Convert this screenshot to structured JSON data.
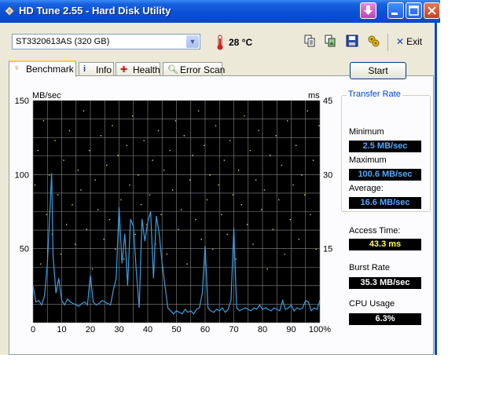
{
  "window": {
    "title": "HD Tune 2.55 - Hard Disk Utility"
  },
  "toolbar": {
    "drive": "ST3320613AS (320 GB)",
    "temperature": "28 °C",
    "exit_label": "Exit",
    "icons": [
      "copy-text-icon",
      "copy-screenshot-icon",
      "save-icon",
      "options-icon"
    ]
  },
  "tabs": [
    {
      "label": "Benchmark",
      "icon": "benchmark-icon",
      "active": true
    },
    {
      "label": "Info",
      "icon": "info-icon",
      "active": false
    },
    {
      "label": "Health",
      "icon": "health-icon",
      "active": false
    },
    {
      "label": "Error Scan",
      "icon": "error-scan-icon",
      "active": false
    }
  ],
  "benchmark": {
    "start_label": "Start",
    "transfer_rate_title": "Transfer Rate",
    "minimum_label": "Minimum",
    "minimum_value": "2.5 MB/sec",
    "maximum_label": "Maximum",
    "maximum_value": "100.6 MB/sec",
    "average_label": "Average:",
    "average_value": "16.6 MB/sec",
    "access_time_label": "Access Time:",
    "access_time_value": "43.3 ms",
    "burst_rate_label": "Burst Rate",
    "burst_rate_value": "35.3 MB/sec",
    "cpu_usage_label": "CPU Usage",
    "cpu_usage_value": "6.3%"
  },
  "chart_data": {
    "type": "line",
    "ylabel": "MB/sec",
    "y2label": "ms",
    "ylim": [
      0,
      150
    ],
    "y2lim": [
      0,
      45
    ],
    "xlim": [
      0,
      100
    ],
    "xticks": [
      "0",
      "10",
      "20",
      "30",
      "40",
      "50",
      "60",
      "70",
      "80",
      "90",
      "100%"
    ],
    "yticks": [
      "150",
      "100",
      "50"
    ],
    "y2ticks": [
      "45",
      "30",
      "15"
    ],
    "grid": true,
    "colors": {
      "background": "#000000",
      "grid": "#8a8a8a",
      "transfer": "#3a9fe0",
      "access": "#d8d840"
    },
    "series": [
      {
        "x": [
          0,
          1,
          2,
          3,
          4,
          5,
          6,
          6.5,
          7,
          8,
          9,
          10,
          11,
          12,
          13,
          14,
          15,
          16,
          17,
          18,
          19,
          20,
          21,
          22,
          23,
          24,
          25,
          26,
          27,
          28,
          29,
          30,
          31,
          32,
          33,
          34,
          35,
          36,
          37,
          38,
          39,
          40,
          41,
          42,
          43,
          44,
          45,
          46,
          47,
          48,
          49,
          50,
          51,
          52,
          53,
          54,
          55,
          56,
          57,
          58,
          59,
          60,
          61,
          62,
          63,
          64,
          65,
          66,
          67,
          68,
          69,
          70,
          71,
          72,
          73,
          74,
          75,
          76,
          77,
          78,
          79,
          80,
          81,
          82,
          83,
          84,
          85,
          86,
          87,
          88,
          89,
          90,
          91,
          92,
          93,
          94,
          95,
          96,
          97,
          98,
          99,
          100
        ],
        "values": [
          25,
          14,
          15,
          12,
          18,
          40,
          80,
          101,
          45,
          20,
          30,
          15,
          12,
          16,
          14,
          13,
          12,
          11,
          13,
          14,
          12,
          32,
          14,
          12,
          13,
          15,
          14,
          13,
          12,
          22,
          30,
          78,
          40,
          60,
          25,
          70,
          65,
          35,
          10,
          70,
          55,
          68,
          75,
          30,
          72,
          60,
          40,
          25,
          10,
          8,
          6,
          8,
          7,
          6,
          9,
          7,
          8,
          6,
          9,
          10,
          20,
          52,
          10,
          8,
          7,
          9,
          8,
          10,
          7,
          9,
          15,
          64,
          10,
          8,
          9,
          10,
          9,
          8,
          10,
          9,
          12,
          9,
          10,
          9,
          8,
          10,
          9,
          8,
          15,
          9,
          10,
          12,
          8,
          10,
          9,
          10,
          15,
          14,
          8,
          10,
          9,
          15
        ]
      }
    ],
    "access_points_ms": [
      28,
      35,
      12,
      41,
      22,
      30,
      18,
      37,
      26,
      14,
      33,
      20,
      39,
      24,
      16,
      31,
      27,
      43,
      19,
      35,
      11,
      29,
      23,
      38,
      17,
      32,
      21,
      40,
      15,
      34,
      25,
      13,
      36,
      28,
      42,
      18,
      30,
      24,
      37,
      20,
      26,
      33,
      16,
      39,
      22,
      31,
      14,
      35,
      27,
      41,
      19,
      23,
      38,
      12,
      29,
      34,
      21,
      43,
      17,
      36,
      25,
      30,
      15,
      40,
      28,
      22,
      33,
      18,
      37,
      26,
      13,
      31,
      24,
      42,
      20,
      35,
      16,
      29,
      39,
      23,
      27,
      11,
      34,
      19,
      38,
      25,
      32,
      14,
      41,
      21,
      28,
      36,
      17,
      30,
      26,
      43,
      22,
      33,
      15,
      40
    ]
  }
}
